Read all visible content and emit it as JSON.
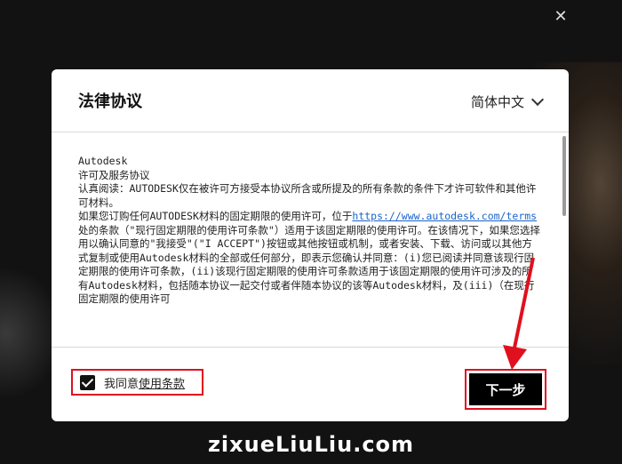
{
  "window": {
    "close_glyph": "✕"
  },
  "dialog": {
    "title": "法律协议",
    "language": "简体中文",
    "content": {
      "line1": "Autodesk",
      "line2": "许可及服务协议",
      "line3": "认真阅读：AUTODESK仅在被许可方接受本协议所含或所提及的所有条款的条件下才许可软件和其他许可材料。",
      "line4_pre": "如果您订购任何AUTODESK材料的固定期限的使用许可，位于",
      "line4_link": "https://www.autodesk.com/terms",
      "line4_post": "处的条款（\"现行固定期限的使用许可条款\"）适用于该固定期限的使用许可。在该情况下，如果您选择用以确认同意的\"我接受\"(\"I ACCEPT\")按钮或其他按钮或机制，或者安装、下载、访问或以其他方式复制或使用Autodesk材料的全部或任何部分，即表示您确认并同意：(i)您已阅读并同意该现行固定期限的使用许可条款，(ii)该现行固定期限的使用许可条款适用于该固定期限的使用许可涉及的所有Autodesk材料，包括随本协议一起交付或者伴随本协议的该等Autodesk材料，及(iii)（在现行固定期限的使用许可"
    },
    "agree_prefix": "我同意",
    "agree_link": "使用条款",
    "next_button": "下一步"
  },
  "colors": {
    "highlight": "#e0101e",
    "link": "#1a64c8"
  },
  "watermark": "zixueLiuLiu.com"
}
